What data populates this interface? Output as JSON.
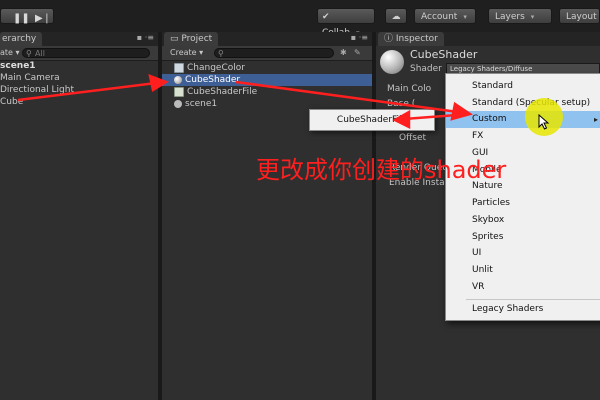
{
  "toolbar": {
    "collab": "Collab",
    "account": "Account",
    "layers": "Layers",
    "layout": "Layout"
  },
  "hierarchy": {
    "tab": "erarchy",
    "create": "ate",
    "search_placeholder": "All",
    "scene": "scene1",
    "items": [
      "Main Camera",
      "Directional Light",
      "Cube"
    ]
  },
  "project": {
    "tab": "Project",
    "create": "Create",
    "items": [
      "ChangeColor",
      "CubeShader",
      "CubeShaderFile",
      "scene1"
    ],
    "selected_index": 1
  },
  "inspector": {
    "tab": "Inspector",
    "material_name": "CubeShader",
    "shader_label": "Shader",
    "shader_value": "Legacy Shaders/Diffuse",
    "labels": {
      "main_color": "Main Colo",
      "base": "Base (",
      "offset": "Offset",
      "render_queue": "Render Queu",
      "enable_instancing": "Enable Instan"
    }
  },
  "shader_menu": {
    "items": [
      "Standard",
      "Standard (Specular setup)",
      "Custom",
      "FX",
      "GUI",
      "Mobile",
      "Nature",
      "Particles",
      "Skybox",
      "Sprites",
      "UI",
      "Unlit",
      "VR"
    ],
    "highlighted_index": 2,
    "footer_item": "Legacy Shaders"
  },
  "submenu": {
    "item": "CubeShaderFile"
  },
  "annotation": {
    "text": "更改成你创建的shader"
  },
  "colors": {
    "selection": "#3e5f96",
    "menu_highlight": "#90c2ef",
    "annotation": "#ff1f1f",
    "cursor_halo": "#e8e600"
  }
}
